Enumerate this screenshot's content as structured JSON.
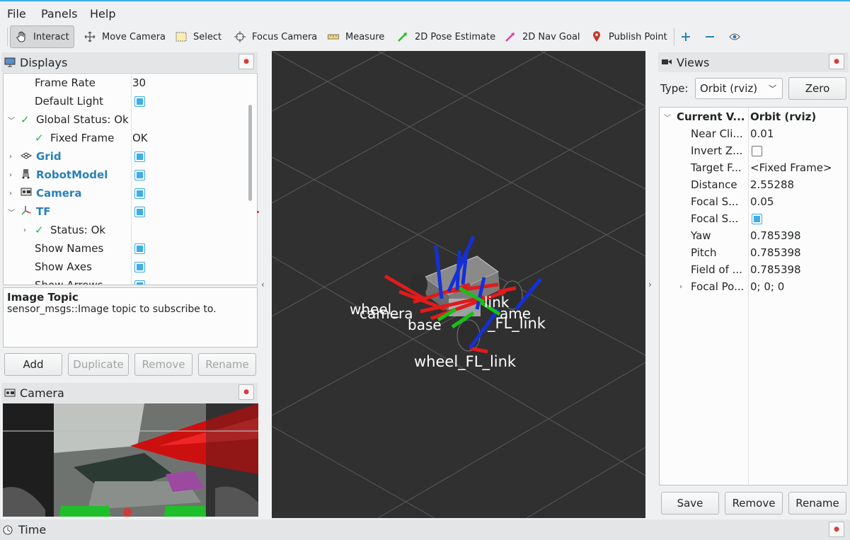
{
  "menu": [
    "File",
    "Panels",
    "Help"
  ],
  "toolbar": {
    "tools": [
      "Interact",
      "Move Camera",
      "Select",
      "Focus Camera",
      "Measure",
      "2D Pose Estimate",
      "2D Nav Goal",
      "Publish Point"
    ],
    "icons": [
      "hand-icon",
      "move-camera-icon",
      "select-icon",
      "focus-camera-icon",
      "measure-icon",
      "pose-estimate-icon",
      "nav-goal-icon",
      "publish-point-icon"
    ],
    "extra_icons": [
      "plus-icon",
      "minus-icon",
      "eye-icon"
    ]
  },
  "displays": {
    "title": "Displays",
    "rows": [
      {
        "label": "Frame Rate",
        "value": "30"
      },
      {
        "label": "Default Light",
        "value": ""
      },
      {
        "label": "Global Status: Ok",
        "value": ""
      },
      {
        "label": "Fixed Frame",
        "value": "OK"
      },
      {
        "label": "Grid",
        "value": ""
      },
      {
        "label": "RobotModel",
        "value": ""
      },
      {
        "label": "Camera",
        "value": ""
      },
      {
        "label": "TF",
        "value": ""
      },
      {
        "label": "Status: Ok",
        "value": ""
      },
      {
        "label": "Show Names",
        "value": ""
      },
      {
        "label": "Show Axes",
        "value": ""
      },
      {
        "label": "Show Arrows",
        "value": ""
      }
    ],
    "desc_title": "Image Topic",
    "desc_text": "sensor_msgs::Image topic to subscribe to.",
    "buttons": [
      "Add",
      "Duplicate",
      "Remove",
      "Rename"
    ]
  },
  "camera_panel": {
    "title": "Camera"
  },
  "time_panel": {
    "title": "Time"
  },
  "viewport": {
    "labels": [
      "wheel_FL_link",
      "_FL_link",
      "wheel_",
      "camera",
      "base",
      "link",
      "ame"
    ]
  },
  "views": {
    "title": "Views",
    "type_label": "Type:",
    "type_value": "Orbit (rviz)",
    "zero_button": "Zero",
    "rows": [
      {
        "label": "Current V...",
        "value": "Orbit (rviz)"
      },
      {
        "label": "Near Cli...",
        "value": "0.01"
      },
      {
        "label": "Invert Z...",
        "value": ""
      },
      {
        "label": "Target F...",
        "value": "<Fixed Frame>"
      },
      {
        "label": "Distance",
        "value": "2.55288"
      },
      {
        "label": "Focal S...",
        "value": "0.05"
      },
      {
        "label": "Focal S...",
        "value": ""
      },
      {
        "label": "Yaw",
        "value": "0.785398"
      },
      {
        "label": "Pitch",
        "value": "0.785398"
      },
      {
        "label": "Field of ...",
        "value": "0.785398"
      },
      {
        "label": "Focal Po...",
        "value": "0; 0; 0"
      }
    ],
    "buttons": [
      "Save",
      "Remove",
      "Rename"
    ]
  }
}
